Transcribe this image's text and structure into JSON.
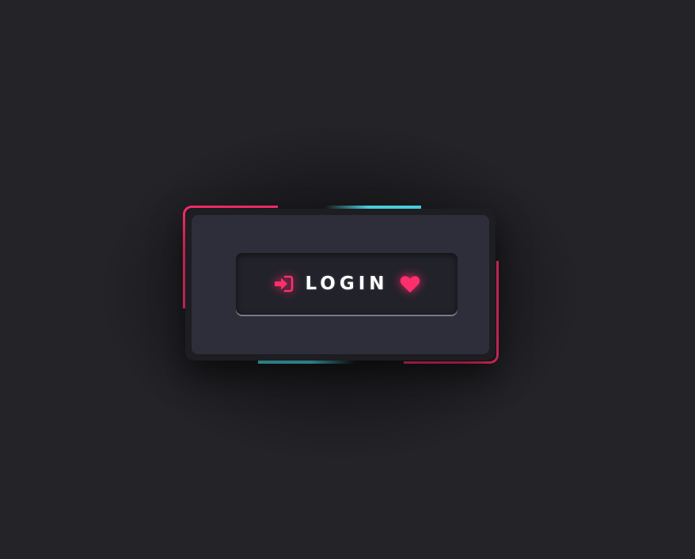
{
  "login_button": {
    "label": "LOGIN",
    "leading_icon": "login-arrow-icon",
    "trailing_icon": "heart-icon"
  },
  "colors": {
    "background": "#242328",
    "card_frame": "#1d1d22",
    "card_surface": "#2e2e3a",
    "button_surface": "#22222a",
    "accent_pink": "#ff2f6e",
    "accent_cyan": "#4ce0ec",
    "label_text": "#ffffff"
  }
}
